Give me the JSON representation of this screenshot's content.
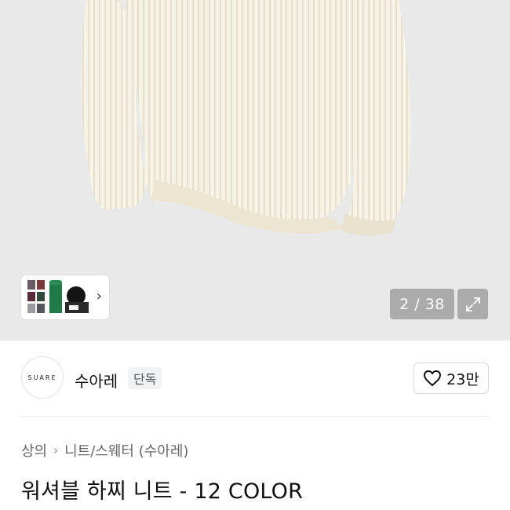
{
  "gallery": {
    "counter_text": "2 / 38",
    "swatch_more_icon": "chevron-right-icon",
    "expand_icon": "expand-icon",
    "colors": {
      "background": "#e9e9ea",
      "sweater": "#f3efe1"
    }
  },
  "brand": {
    "logo_text": "SUARE",
    "name": "수아레",
    "badge": "단독"
  },
  "like": {
    "icon": "heart-icon",
    "count": "23만"
  },
  "breadcrumb": {
    "items": [
      "상의",
      "니트/스웨터 (수아레)"
    ],
    "separator": "›"
  },
  "product": {
    "title": "워셔블 하찌 니트 - 12 COLOR"
  }
}
